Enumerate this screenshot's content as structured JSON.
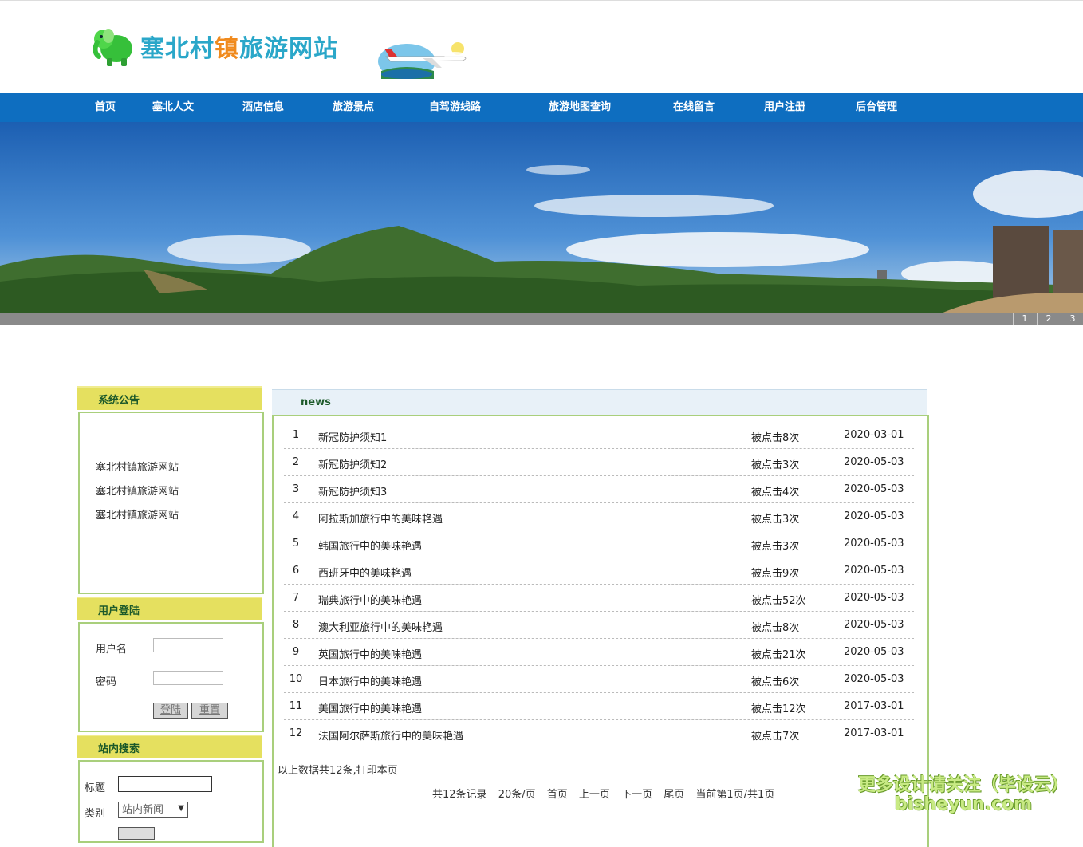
{
  "site": {
    "title_part1": "塞北村",
    "title_part2": "镇",
    "title_part3": "旅游网站"
  },
  "nav": [
    "首页",
    "塞北人文",
    "酒店信息",
    "旅游景点",
    "自驾游线路",
    "旅游地图查询",
    "在线留言",
    "用户注册",
    "后台管理"
  ],
  "banner": {
    "pages": [
      "1",
      "2",
      "3"
    ]
  },
  "notice": {
    "title": "系统公告",
    "items": [
      "塞北村镇旅游网站",
      "塞北村镇旅游网站",
      "塞北村镇旅游网站"
    ]
  },
  "login": {
    "title": "用户登陆",
    "username_label": "用户名",
    "password_label": "密码",
    "login_button": "登陆",
    "reset_button": "重置"
  },
  "search": {
    "title": "站内搜索",
    "title_label": "标题",
    "category_label": "类别",
    "category_value": "站内新闻"
  },
  "news": {
    "title": "news",
    "rows": [
      {
        "no": "1",
        "title": "新冠防护须知1",
        "clicks": "被点击8次",
        "date": "2020-03-01"
      },
      {
        "no": "2",
        "title": "新冠防护须知2",
        "clicks": "被点击3次",
        "date": "2020-05-03"
      },
      {
        "no": "3",
        "title": "新冠防护须知3",
        "clicks": "被点击4次",
        "date": "2020-05-03"
      },
      {
        "no": "4",
        "title": "阿拉斯加旅行中的美味艳遇",
        "clicks": "被点击3次",
        "date": "2020-05-03"
      },
      {
        "no": "5",
        "title": "韩国旅行中的美味艳遇",
        "clicks": "被点击3次",
        "date": "2020-05-03"
      },
      {
        "no": "6",
        "title": "西班牙中的美味艳遇",
        "clicks": "被点击9次",
        "date": "2020-05-03"
      },
      {
        "no": "7",
        "title": "瑞典旅行中的美味艳遇",
        "clicks": "被点击52次",
        "date": "2020-05-03"
      },
      {
        "no": "8",
        "title": "澳大利亚旅行中的美味艳遇",
        "clicks": "被点击8次",
        "date": "2020-05-03"
      },
      {
        "no": "9",
        "title": "英国旅行中的美味艳遇",
        "clicks": "被点击21次",
        "date": "2020-05-03"
      },
      {
        "no": "10",
        "title": "日本旅行中的美味艳遇",
        "clicks": "被点击6次",
        "date": "2020-05-03"
      },
      {
        "no": "11",
        "title": "美国旅行中的美味艳遇",
        "clicks": "被点击12次",
        "date": "2017-03-01"
      },
      {
        "no": "12",
        "title": "法国阿尔萨斯旅行中的美味艳遇",
        "clicks": "被点击7次",
        "date": "2017-03-01"
      }
    ],
    "summary": "以上数据共12条,打印本页",
    "pager": {
      "total": "共12条记录",
      "per_page": "20条/页",
      "first": "首页",
      "prev": "上一页",
      "next": "下一页",
      "last": "尾页",
      "current": "当前第1页/共1页"
    }
  },
  "watermark": {
    "line1": "更多设计请关注（毕设云）",
    "line2": "bisheyun.com"
  }
}
